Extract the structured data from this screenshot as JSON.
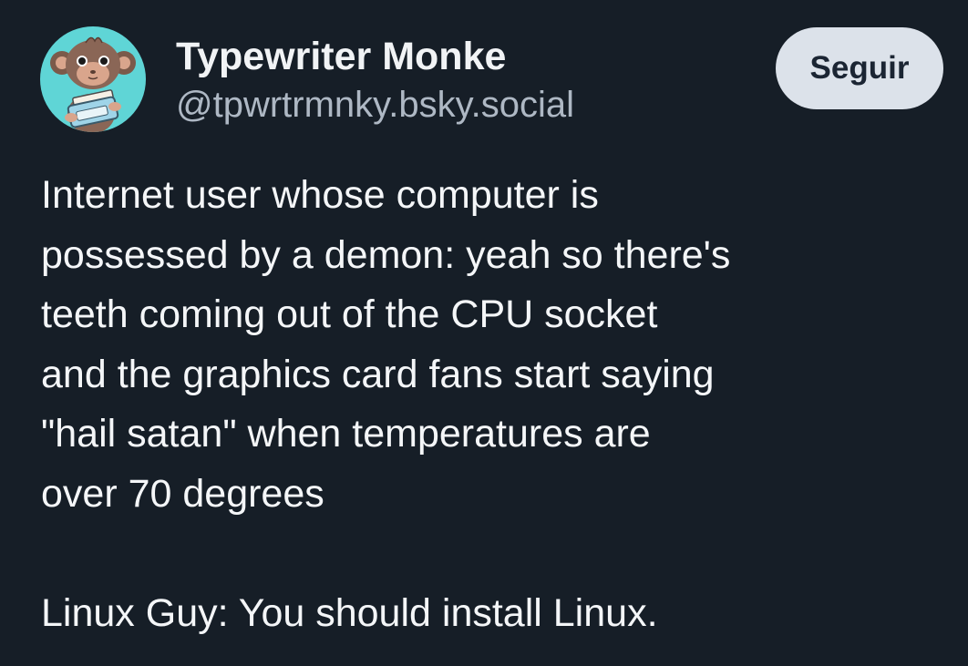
{
  "author": {
    "display_name": "Typewriter Monke",
    "handle": "@tpwrtrmnky.bsky.social",
    "avatar_icon": "monkey-with-typewriter-avatar"
  },
  "follow_button": {
    "label": "Seguir"
  },
  "post": {
    "lines": [
      "Internet user whose computer is",
      "possessed by a demon: yeah so there's",
      "teeth coming out of the CPU socket",
      "and the graphics card fans start saying",
      "\"hail satan\" when temperatures are",
      "over 70 degrees"
    ],
    "punchline": "Linux Guy: You should install Linux."
  },
  "colors": {
    "background": "#161e27",
    "avatar_bg": "#5fd5d6",
    "button_bg": "#dce2ea",
    "handle": "#aeb8c4"
  }
}
